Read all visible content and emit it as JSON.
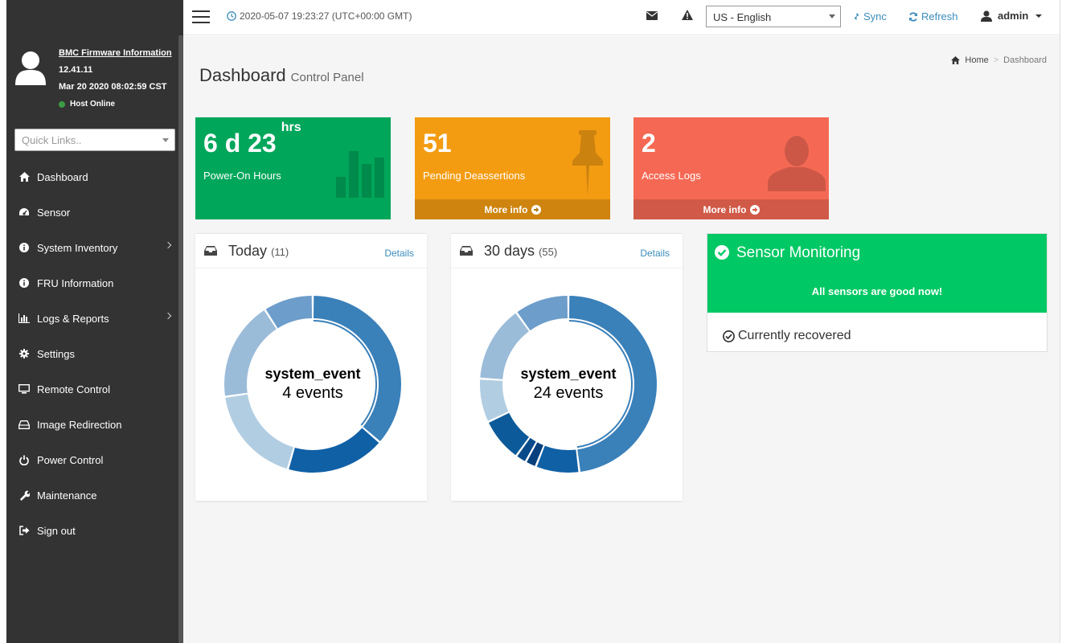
{
  "sidebar": {
    "firmware_title": "BMC Firmware Information",
    "firmware_version": "12.41.11",
    "firmware_date": "Mar 20 2020 08:02:59 CST",
    "host_status": "Host Online",
    "quick_links_placeholder": "Quick Links..",
    "items": [
      {
        "label": "Dashboard",
        "icon": "home-icon"
      },
      {
        "label": "Sensor",
        "icon": "gauge-icon"
      },
      {
        "label": "System Inventory",
        "icon": "info-icon",
        "has_children": true
      },
      {
        "label": "FRU Information",
        "icon": "info-icon"
      },
      {
        "label": "Logs & Reports",
        "icon": "bar-chart-icon",
        "has_children": true
      },
      {
        "label": "Settings",
        "icon": "gear-icon"
      },
      {
        "label": "Remote Control",
        "icon": "monitor-icon"
      },
      {
        "label": "Image Redirection",
        "icon": "drive-icon"
      },
      {
        "label": "Power Control",
        "icon": "power-icon"
      },
      {
        "label": "Maintenance",
        "icon": "wrench-icon"
      },
      {
        "label": "Sign out",
        "icon": "sign-out-icon"
      }
    ]
  },
  "topbar": {
    "datetime": "2020-05-07 19:23:27 (UTC+00:00 GMT)",
    "language": "US - English",
    "sync_label": "Sync",
    "refresh_label": "Refresh",
    "user": "admin"
  },
  "page": {
    "title": "Dashboard",
    "subtitle": "Control Panel",
    "breadcrumb_home": "Home",
    "breadcrumb_current": "Dashboard"
  },
  "boxes": {
    "power_on": {
      "value": "6 d 23",
      "unit": "hrs",
      "label": "Power-On Hours",
      "color": "#00a65a"
    },
    "deassertions": {
      "value": "51",
      "label": "Pending Deassertions",
      "footer": "More info",
      "color": "#f39c12"
    },
    "access_logs": {
      "value": "2",
      "label": "Access Logs",
      "footer": "More info",
      "color": "#f56954"
    }
  },
  "today": {
    "title": "Today",
    "count": "(11)",
    "details": "Details",
    "center_name": "system_event",
    "center_events": "4 events"
  },
  "days30": {
    "title": "30 days",
    "count": "(55)",
    "details": "Details",
    "center_name": "system_event",
    "center_events": "24 events"
  },
  "sensor": {
    "title": "Sensor Monitoring",
    "message": "All sensors are good now!",
    "status": "Currently recovered",
    "color": "#00c864"
  },
  "chart_data": [
    {
      "type": "pie",
      "title": "Today",
      "values": [
        4,
        2,
        2,
        2,
        1
      ],
      "colors": [
        "#3a80b9",
        "#1060a6",
        "#b1cde2",
        "#9bbcd9",
        "#6d9dca"
      ]
    },
    {
      "type": "pie",
      "title": "30 days",
      "values": [
        24,
        4,
        1,
        1,
        4,
        4,
        7,
        5
      ],
      "colors": [
        "#3a80b9",
        "#1060a6",
        "#08407e",
        "#084a8a",
        "#0c5a99",
        "#b1cde2",
        "#9bbcd9",
        "#6d9dca"
      ]
    }
  ]
}
